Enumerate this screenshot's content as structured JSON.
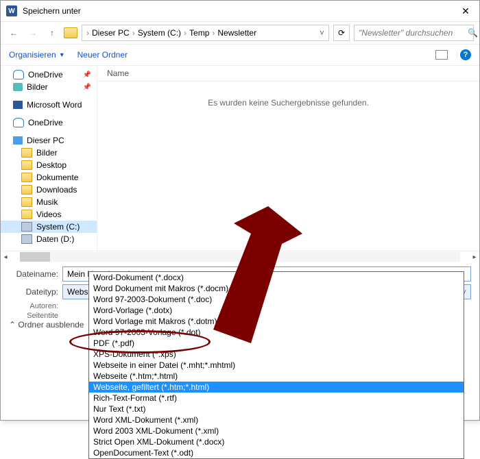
{
  "window": {
    "title": "Speichern unter"
  },
  "breadcrumb": [
    "Dieser PC",
    "System (C:)",
    "Temp",
    "Newsletter"
  ],
  "search": {
    "placeholder": "\"Newsletter\" durchsuchen"
  },
  "toolbar": {
    "organize": "Organisieren",
    "new_folder": "Neuer Ordner"
  },
  "tree": [
    {
      "label": "OneDrive",
      "icon": "ti-cloud",
      "pin": true
    },
    {
      "label": "Bilder",
      "icon": "ti-pic",
      "pin": true
    },
    {
      "label": "Microsoft Word",
      "icon": "ti-word",
      "pin": false,
      "spacer_before": true
    },
    {
      "label": "OneDrive",
      "icon": "ti-cloud",
      "pin": false,
      "spacer_before": true
    },
    {
      "label": "Dieser PC",
      "icon": "ti-pc",
      "pin": false,
      "spacer_before": true
    },
    {
      "label": "Bilder",
      "icon": "ti-folder",
      "pin": false,
      "indent": true
    },
    {
      "label": "Desktop",
      "icon": "ti-folder",
      "pin": false,
      "indent": true
    },
    {
      "label": "Dokumente",
      "icon": "ti-folder",
      "pin": false,
      "indent": true
    },
    {
      "label": "Downloads",
      "icon": "ti-folder",
      "pin": false,
      "indent": true
    },
    {
      "label": "Musik",
      "icon": "ti-folder",
      "pin": false,
      "indent": true
    },
    {
      "label": "Videos",
      "icon": "ti-folder",
      "pin": false,
      "indent": true
    },
    {
      "label": "System (C:)",
      "icon": "ti-disk",
      "pin": false,
      "indent": true,
      "selected": true
    },
    {
      "label": "Daten (D:)",
      "icon": "ti-disk",
      "pin": false,
      "indent": true
    }
  ],
  "columns": {
    "name": "Name"
  },
  "empty": "Es wurden keine Suchergebnisse gefunden.",
  "form": {
    "filename_label": "Dateiname:",
    "filename_value": "Mein Newsletter.html",
    "filetype_label": "Dateityp:",
    "filetype_value": "Webseite, gefiltert (*.htm;*.html)",
    "authors_label": "Autoren:",
    "pagetitle_label": "Seitentite"
  },
  "hide_folders": "Ordner ausblende",
  "dropdown": [
    "Word-Dokument (*.docx)",
    "Word Dokument mit Makros (*.docm)",
    "Word 97-2003-Dokument (*.doc)",
    "Word-Vorlage (*.dotx)",
    "Word Vorlage mit Makros (*.dotm)",
    "Word 97-2003-Vorlage (*.dot)",
    "PDF (*.pdf)",
    "XPS-Dokument (*.xps)",
    "Webseite in einer Datei (*.mht;*.mhtml)",
    "Webseite (*.htm;*.html)",
    "Webseite, gefiltert (*.htm;*.html)",
    "Rich-Text-Format (*.rtf)",
    "Nur Text (*.txt)",
    "Word XML-Dokument (*.xml)",
    "Word 2003 XML-Dokument (*.xml)",
    "Strict Open XML-Dokument (*.docx)",
    "OpenDocument-Text (*.odt)"
  ],
  "dropdown_selected_index": 10
}
